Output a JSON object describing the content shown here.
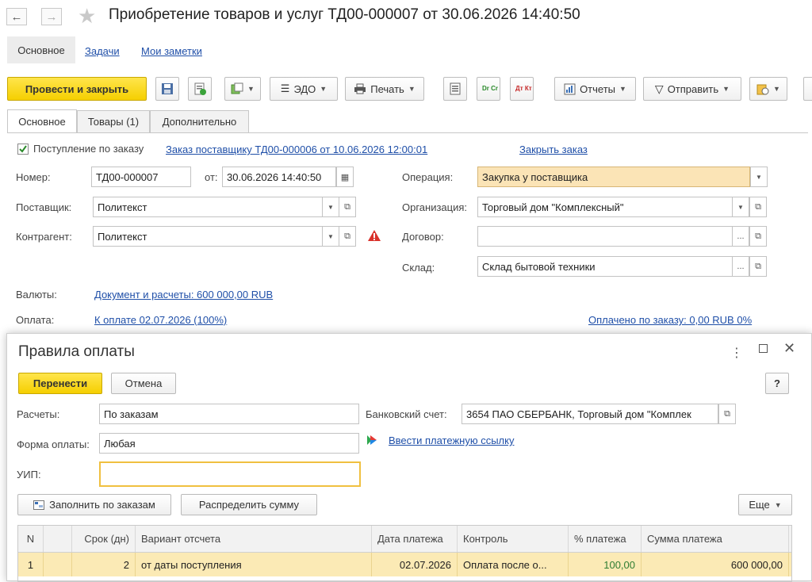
{
  "window": {
    "title": "Приобретение товаров и услуг ТД00-000007 от 30.06.2026 14:40:50",
    "nav_back": "←",
    "nav_forward": "→"
  },
  "top_tabs": [
    "Основное",
    "Задачи",
    "Мои заметки"
  ],
  "toolbar": {
    "post_close": "Провести и закрыть",
    "edo": "ЭДО",
    "print": "Печать",
    "dr_cr": "Dr Cr",
    "dt_kt": "Дт Кт",
    "reports": "Отчеты",
    "send": "Отправить"
  },
  "doc_tabs": [
    "Основное",
    "Товары (1)",
    "Дополнительно"
  ],
  "form": {
    "order_checkbox_label": "Поступление по заказу",
    "order_link": "Заказ поставщику ТД00-000006 от 10.06.2026 12:00:01",
    "close_order_link": "Закрыть заказ",
    "number_label": "Номер:",
    "number_value": "ТД00-000007",
    "date_label": "от:",
    "date_value": "30.06.2026 14:40:50",
    "supplier_label": "Поставщик:",
    "supplier_value": "Политекст",
    "counterparty_label": "Контрагент:",
    "counterparty_value": "Политекст",
    "operation_label": "Операция:",
    "operation_value": "Закупка у поставщика",
    "organization_label": "Организация:",
    "organization_value": "Торговый дом \"Комплексный\"",
    "contract_label": "Договор:",
    "contract_value": "",
    "warehouse_label": "Склад:",
    "warehouse_value": "Склад бытовой техники",
    "currency_label": "Валюты:",
    "currency_link": "Документ и расчеты: 600 000,00 RUB",
    "payment_label": "Оплата:",
    "payment_link": "К оплате 02.07.2026 (100%)",
    "paid_link": "Оплачено по заказу: 0,00 RUB 0%"
  },
  "dialog": {
    "title": "Правила оплаты",
    "transfer_button": "Перенести",
    "cancel_button": "Отмена",
    "help_button": "?",
    "settlements_label": "Расчеты:",
    "settlements_value": "По заказам",
    "payment_form_label": "Форма оплаты:",
    "payment_form_value": "Любая",
    "uip_label": "УИП:",
    "uip_value": "",
    "bank_account_label": "Банковский счет:",
    "bank_account_value": "3654 ПАО СБЕРБАНК, Торговый дом \"Комплек",
    "payment_link_action": "Ввести платежную ссылку",
    "fill_by_orders_button": "Заполнить по заказам",
    "distribute_button": "Распределить сумму",
    "more_button": "Еще",
    "table": {
      "columns": [
        "N",
        "",
        "Срок (дн)",
        "Вариант отсчета",
        "Дата платежа",
        "Контроль",
        "% платежа",
        "Сумма платежа"
      ],
      "rows": [
        [
          "1",
          "",
          "2",
          "от даты поступления",
          "02.07.2026",
          "Оплата после о...",
          "100,00",
          "600 000,00"
        ]
      ]
    }
  },
  "colors": {
    "primary_button": "#f5cf00",
    "link": "#1f4fa8",
    "highlight_field": "#fbe4b6",
    "selected_row": "#fbeab5",
    "percent_text": "#2e7d32"
  }
}
